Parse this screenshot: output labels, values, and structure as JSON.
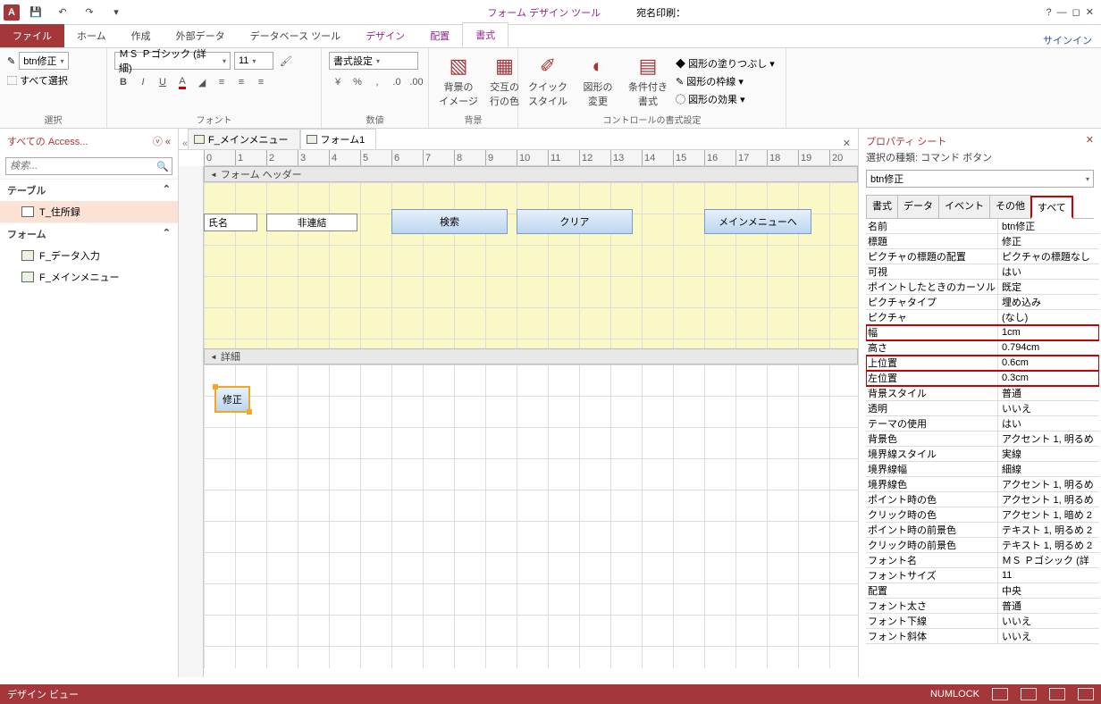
{
  "titlebar": {
    "tool_title": "フォーム デザイン ツール",
    "doc_title": "宛名印刷："
  },
  "tabs": {
    "file": "ファイル",
    "home": "ホーム",
    "create": "作成",
    "external": "外部データ",
    "dbtools": "データベース ツール",
    "design": "デザイン",
    "arrange": "配置",
    "format": "書式",
    "signin": "サインイン"
  },
  "ribbon": {
    "selection_combo": "btn修正",
    "select_all": "すべて選択",
    "g1": "選択",
    "font_name": "ＭＳ Ｐゴシック (詳細)",
    "font_size": "11",
    "g2": "フォント",
    "fmt_label": "書式設定",
    "g3": "数値",
    "bgimg": "背景の\nイメージ",
    "altrow": "交互の\n行の色",
    "g4": "背景",
    "quick": "クイック\nスタイル",
    "shapech": "図形の\n変更",
    "cond": "条件付き\n書式",
    "fill": "図形の塗りつぶし",
    "outline": "図形の枠線",
    "effects": "図形の効果",
    "g5": "コントロールの書式設定"
  },
  "nav": {
    "title": "すべての Access...",
    "search_ph": "検索...",
    "g_tables": "テーブル",
    "t1": "T_住所録",
    "g_forms": "フォーム",
    "f1": "F_データ入力",
    "f2": "F_メインメニュー"
  },
  "doctabs": {
    "t1": "F_メインメニュー",
    "t2": "フォーム1"
  },
  "sections": {
    "header": "フォーム ヘッダー",
    "detail": "詳細"
  },
  "controls": {
    "lbl_name": "氏名",
    "txt_unbound": "非連結",
    "btn_search": "検索",
    "btn_clear": "クリア",
    "btn_main": "メインメニューへ",
    "btn_edit": "修正"
  },
  "props": {
    "title": "プロパティ シート",
    "subtitle": "選択の種類: コマンド ボタン",
    "selected": "btn修正",
    "tabs": {
      "fmt": "書式",
      "data": "データ",
      "event": "イベント",
      "other": "その他",
      "all": "すべて"
    },
    "rows": [
      [
        "名前",
        "btn修正",
        0
      ],
      [
        "標題",
        "修正",
        0
      ],
      [
        "ピクチャの標題の配置",
        "ピクチャの標題なし",
        0
      ],
      [
        "可視",
        "はい",
        0
      ],
      [
        "ポイントしたときのカーソル",
        "既定",
        0
      ],
      [
        "ピクチャタイプ",
        "埋め込み",
        0
      ],
      [
        "ピクチャ",
        "(なし)",
        0
      ],
      [
        "幅",
        "1cm",
        1
      ],
      [
        "高さ",
        "0.794cm",
        0
      ],
      [
        "上位置",
        "0.6cm",
        1
      ],
      [
        "左位置",
        "0.3cm",
        1
      ],
      [
        "背景スタイル",
        "普通",
        0
      ],
      [
        "透明",
        "いいえ",
        0
      ],
      [
        "テーマの使用",
        "はい",
        0
      ],
      [
        "背景色",
        "アクセント 1, 明るめ",
        0
      ],
      [
        "境界線スタイル",
        "実線",
        0
      ],
      [
        "境界線幅",
        "細線",
        0
      ],
      [
        "境界線色",
        "アクセント 1, 明るめ",
        0
      ],
      [
        "ポイント時の色",
        "アクセント 1, 明るめ",
        0
      ],
      [
        "クリック時の色",
        "アクセント 1, 暗め 2",
        0
      ],
      [
        "ポイント時の前景色",
        "テキスト 1, 明るめ 2",
        0
      ],
      [
        "クリック時の前景色",
        "テキスト 1, 明るめ 2",
        0
      ],
      [
        "フォント名",
        "ＭＳ Ｐゴシック (詳",
        0
      ],
      [
        "フォントサイズ",
        "11",
        0
      ],
      [
        "配置",
        "中央",
        0
      ],
      [
        "フォント太さ",
        "普通",
        0
      ],
      [
        "フォント下線",
        "いいえ",
        0
      ],
      [
        "フォント斜体",
        "いいえ",
        0
      ]
    ]
  },
  "status": {
    "view": "デザイン ビュー",
    "numlock": "NUMLOCK"
  }
}
